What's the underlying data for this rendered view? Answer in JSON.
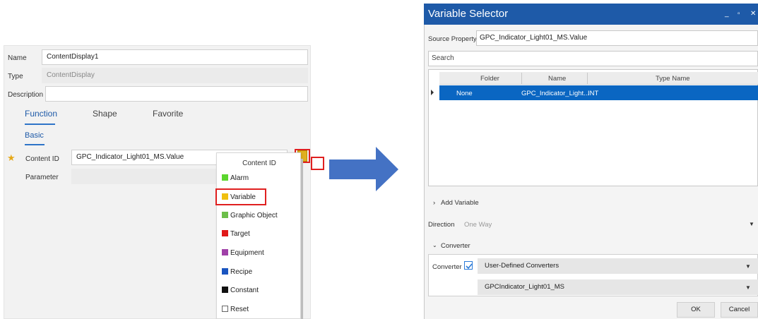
{
  "left_panel": {
    "name_label": "Name",
    "name_value": "ContentDisplay1",
    "type_label": "Type",
    "type_value": "ContentDisplay",
    "description_label": "Description",
    "description_value": "",
    "tabs": [
      "Function",
      "Shape",
      "Favorite"
    ],
    "subtab": "Basic",
    "content_id_label": "Content ID",
    "content_id_value": "GPC_Indicator_Light01_MS.Value",
    "parameter_label": "Parameter",
    "parameter_value": ""
  },
  "menu": {
    "header": "Content ID",
    "items": [
      {
        "label": "Alarm",
        "color": "#5cd62e"
      },
      {
        "label": "Variable",
        "color": "#f0c010"
      },
      {
        "label": "Graphic Object",
        "color": "#6cbf4a"
      },
      {
        "label": "Target",
        "color": "#e01818"
      },
      {
        "label": "Equipment",
        "color": "#a040a8"
      },
      {
        "label": "Recipe",
        "color": "#1a55c0"
      },
      {
        "label": "Constant",
        "color": "#111111"
      },
      {
        "label": "Reset",
        "color": "#ffffff"
      }
    ]
  },
  "arrow_color": "#4472c4",
  "dialog": {
    "title": "Variable Selector",
    "controls": [
      "_",
      "▫",
      "✕"
    ],
    "source_property_label": "Source Property",
    "source_property_value": "GPC_Indicator_Light01_MS.Value",
    "search_placeholder": "Search",
    "grid_columns": [
      "Folder",
      "Name",
      "Type Name"
    ],
    "grid_row": {
      "folder": "None",
      "name": "GPC_Indicator_Light...",
      "type_name": "INT"
    },
    "add_variable_label": "Add Variable",
    "direction_label": "Direction",
    "direction_value": "One Way",
    "converter_section_label": "Converter",
    "converter_label": "Converter",
    "converter_type": "User-Defined Converters",
    "converter_name": "GPCIndicator_Light01_MS",
    "ok_label": "OK",
    "cancel_label": "Cancel",
    "title_bar_color": "#1e5aa8"
  }
}
